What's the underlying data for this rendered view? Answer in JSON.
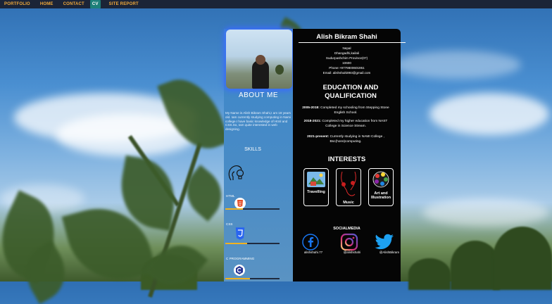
{
  "nav": {
    "items": [
      {
        "label": "PORTFOLIO",
        "active": false
      },
      {
        "label": "HOME",
        "active": false
      },
      {
        "label": "CONTACT",
        "active": false
      },
      {
        "label": "CV",
        "active": true
      },
      {
        "label": "SITE REPORT",
        "active": false
      }
    ]
  },
  "left": {
    "about_title": "ABOUT ME",
    "about_text": "My Name is Alish Bikram Shahi,I am 18 years old. Iam currently studying computing in Nami college.I have basic knowledge of Html and CSS.So, Iam quite interested in web designing.",
    "skills_title": "SKILLS",
    "skills": [
      {
        "label": "HTML",
        "icon": "html5-icon",
        "level": 0.32
      },
      {
        "label": "CSS",
        "icon": "css3-icon",
        "level": 0.4
      },
      {
        "label": "C PROGRAMMING",
        "icon": "c-language-icon",
        "level": 0.45
      }
    ]
  },
  "right": {
    "name": "Alish Bikram Shahi",
    "info": [
      "Nepal",
      "Dhangadhi,kailali",
      "Sudurpashchim Province(07)",
      "10600",
      "Phone:+9779800601951",
      "Email: alishshahi893@gmail.com"
    ],
    "education_title": "EDUCATION AND QUALIFICATION",
    "education": [
      {
        "years": "2005-2018:",
        "text": "Completed my schooling from Stepping Stone English School."
      },
      {
        "years": "2018-2021:",
        "text": "Completed my higher education from NAST College in Science Stream."
      },
      {
        "years": "2021-present:",
        "text": "Currently studying in NAMI College , Bsc(hons)computing."
      }
    ],
    "interests_title": "INTERESTS",
    "interests": [
      {
        "label": "Travelling",
        "icon": "travel-icon"
      },
      {
        "label": "Music",
        "icon": "music-earphones-icon"
      },
      {
        "label": "Art and Illustration",
        "icon": "art-palette-icon"
      }
    ],
    "social_title": "SOCIALMEDIA",
    "social": [
      {
        "handle": "alishshahi.77",
        "icon": "facebook-icon",
        "color": "#1877f2"
      },
      {
        "handle": "@alishshahi",
        "icon": "instagram-icon",
        "color": "#e1306c"
      },
      {
        "handle": "@AlishBikram",
        "icon": "twitter-icon",
        "color": "#1da1f2"
      }
    ]
  },
  "colors": {
    "nav_bg": "#1b2437",
    "nav_text": "#f0a93a",
    "nav_active_bg": "#1d7f79",
    "left_panel": "#4a8cc6",
    "right_panel": "#050505",
    "skill_bar_fill": "#f2b21e"
  }
}
